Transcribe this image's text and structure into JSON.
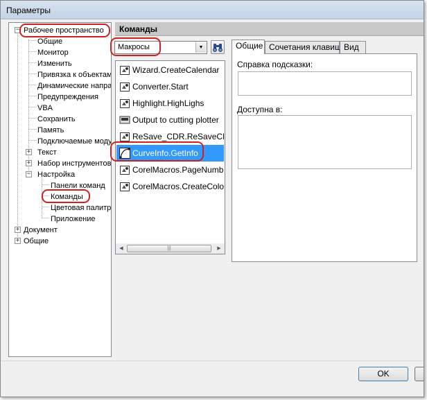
{
  "window": {
    "title": "Параметры"
  },
  "tree": {
    "items": [
      {
        "label": "Рабочее пространство",
        "level": 0,
        "expander": "−"
      },
      {
        "label": "Общие",
        "level": 1
      },
      {
        "label": "Монитор",
        "level": 1
      },
      {
        "label": "Изменить",
        "level": 1
      },
      {
        "label": "Привязка к объектам",
        "level": 1
      },
      {
        "label": "Динамические направляющие",
        "level": 1
      },
      {
        "label": "Предупреждения",
        "level": 1
      },
      {
        "label": "VBA",
        "level": 1
      },
      {
        "label": "Сохранить",
        "level": 1
      },
      {
        "label": "Память",
        "level": 1
      },
      {
        "label": "Подключаемые модули",
        "level": 1
      },
      {
        "label": "Текст",
        "level": 1,
        "expander": "+"
      },
      {
        "label": "Набор инструментов",
        "level": 1,
        "expander": "+"
      },
      {
        "label": "Настройка",
        "level": 1,
        "expander": "−"
      },
      {
        "label": "Панели команд",
        "level": 2
      },
      {
        "label": "Команды",
        "level": 2
      },
      {
        "label": "Цветовая палитра",
        "level": 2
      },
      {
        "label": "Приложение",
        "level": 2
      },
      {
        "label": "Документ",
        "level": 0,
        "expander": "+"
      },
      {
        "label": "Общие",
        "level": 0,
        "expander": "+"
      }
    ]
  },
  "commands": {
    "header": "Команды",
    "category": {
      "value": "Макросы"
    },
    "find_icon": "binoculars-icon",
    "items": [
      {
        "label": "Wizard.CreateCalendar",
        "icon": "macro-icon"
      },
      {
        "label": "Converter.Start",
        "icon": "macro-icon"
      },
      {
        "label": "Highlight.HighLighs",
        "icon": "macro-icon"
      },
      {
        "label": "Output to cutting plotter",
        "icon": "plotter-icon"
      },
      {
        "label": "ReSave_CDR.ReSaveCDR",
        "icon": "macro-icon"
      },
      {
        "label": "CurveInfo.GetInfo",
        "icon": "curve-icon",
        "selected": true
      },
      {
        "label": "CorelMacros.PageNumbering",
        "icon": "macro-icon"
      },
      {
        "label": "CorelMacros.CreateColorSwatch",
        "icon": "macro-icon"
      }
    ]
  },
  "tabs": [
    {
      "label": "Общие",
      "active": true
    },
    {
      "label": "Сочетания клавиш"
    },
    {
      "label": "Вид"
    }
  ],
  "general_tab": {
    "tooltip_help_label": "Справка подсказки:",
    "tooltip_help_value": "",
    "available_in_label": "Доступна в:",
    "available_in_value": ""
  },
  "buttons": {
    "ok": "OK"
  },
  "colors": {
    "selection": "#3399ff",
    "highlight_outline": "#d02020"
  }
}
